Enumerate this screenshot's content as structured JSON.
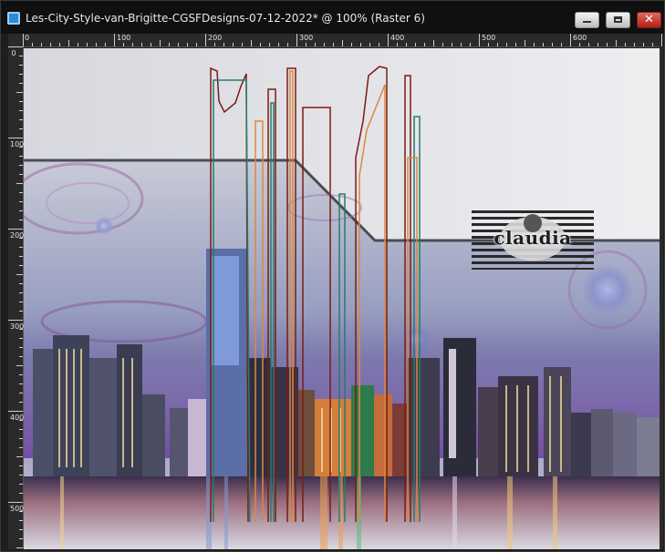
{
  "window": {
    "title": "Les-City-Style-van-Brigitte-CGSFDesigns-07-12-2022* @ 100% (Raster 6)",
    "buttons": {
      "minimize": "minimize-icon",
      "maximize": "maximize-icon",
      "close_label": "✕"
    }
  },
  "ruler": {
    "horizontal_labels": [
      "0",
      "100",
      "200",
      "300",
      "400",
      "500",
      "600"
    ],
    "vertical_labels": [
      "0",
      "100",
      "200",
      "300",
      "400",
      "500"
    ]
  },
  "canvas": {
    "logo_text": "claudia"
  },
  "colors": {
    "title_bg": "#101010",
    "title_text": "#e8e8e8",
    "close_red": "#c4271a",
    "sky_light": "#e6e8ec",
    "sky_blue": "#8f97bd",
    "band_dark": "#24262f",
    "line_red": "#7a1c14",
    "line_teal": "#2a7a6c",
    "line_orange": "#d9893f"
  }
}
